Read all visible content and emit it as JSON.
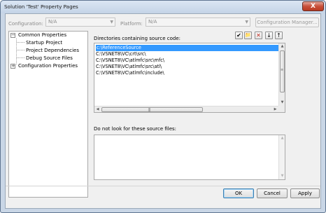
{
  "window": {
    "title": "Solution 'Test' Property Pages",
    "close": "X"
  },
  "toolbar": {
    "configuration_label": "Configuration:",
    "configuration_value": "N/A",
    "platform_label": "Platform:",
    "platform_value": "N/A",
    "config_manager_label": "Configuration Manager...",
    "dropdown_arrow": "▼"
  },
  "tree": {
    "expanded_glyph": "−",
    "collapsed_glyph": "+",
    "items": [
      {
        "label": "Common Properties",
        "state": "expanded"
      },
      {
        "label": "Startup Project"
      },
      {
        "label": "Project Dependencies"
      },
      {
        "label": "Debug Source Files"
      },
      {
        "label": "Configuration Properties",
        "state": "collapsed"
      }
    ]
  },
  "source_dirs": {
    "label": "Directories containing source code:",
    "rows": [
      "c:\\ReferenceSource",
      "C:\\VSNET8\\VC\\crt\\src\\",
      "C:\\VSNET8\\VC\\atlmfc\\src\\mfc\\",
      "C:\\VSNET8\\VC\\atlmfc\\src\\atl\\",
      "C:\\VSNET8\\VC\\atlmfc\\include\\"
    ],
    "selected_index": 0
  },
  "list_tools": {
    "check": "✔",
    "new_folder": "📁",
    "delete": "✕",
    "move_down": "↓",
    "move_up": "↑"
  },
  "exclude_files": {
    "label": "Do not look for these source files:"
  },
  "scroll": {
    "up": "▲",
    "down": "▼",
    "left": "◀",
    "right": "▶",
    "grip_v": "≡",
    "grip_h": "|||"
  },
  "buttons": {
    "ok": "OK",
    "cancel": "Cancel",
    "apply": "Apply"
  },
  "colors": {
    "selection": "#3399ff",
    "frame": "#c9d6e6",
    "close": "#c8503a"
  }
}
